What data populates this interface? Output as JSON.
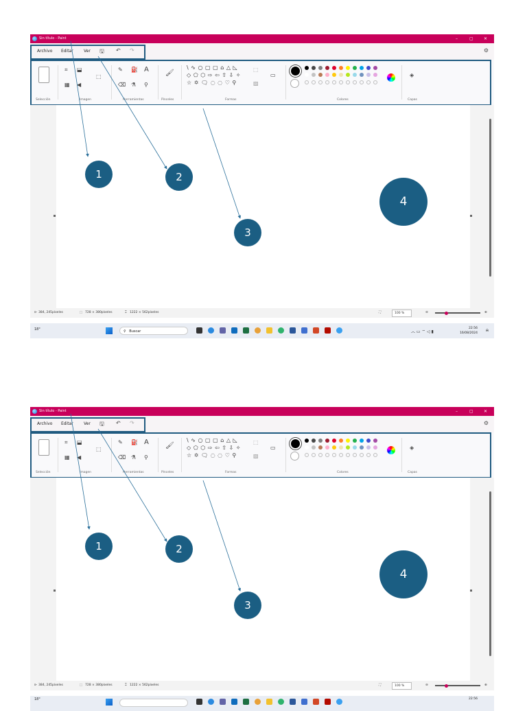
{
  "window": {
    "title": "Sin título - Paint",
    "controls": [
      "–",
      "▢",
      "✕"
    ]
  },
  "menu": {
    "items": [
      "Archivo",
      "Editar",
      "Ver"
    ],
    "icons": [
      "save-icon",
      "undo-icon",
      "redo-icon",
      "settings-icon"
    ]
  },
  "ribbon": {
    "groups": [
      "Selección",
      "Imagen",
      "Herramientas",
      "Pinceles",
      "Formas",
      "Colores",
      "Capas"
    ],
    "shapes_row1": "\\ ∿ ○ ▢ ▢ ⌂ △ ◺",
    "shapes_row2": "◇ ⬠ ⬡ ⇨ ⇦ ⇧ ⇩ ✧",
    "shapes_row3": "☆ ✡ 🗨 ◌ ◌ ♡ ⚲",
    "palette_row1": [
      "#000000",
      "#464646",
      "#7f7f7f",
      "#9c1a2e",
      "#e0002a",
      "#ff7f27",
      "#fff200",
      "#22b14c",
      "#00a2e8",
      "#3f48cc",
      "#a349a4"
    ],
    "palette_row2": [
      "#ffffff",
      "#c3c3c3",
      "#b97a57",
      "#ffaec9",
      "#ffc90e",
      "#efe4b0",
      "#b5e61d",
      "#99d9ea",
      "#7092be",
      "#c8bfe7",
      "#e5a5e0"
    ]
  },
  "status": {
    "cursor": "384, 245píxeles",
    "selection": "728 × 380píxeles",
    "canvas_size": "1222 × 562píxeles",
    "zoom": "100 %"
  },
  "taskbar": {
    "search_placeholder": "Buscar",
    "weather": "18°",
    "time": "22:56",
    "date": "16/08/2024"
  },
  "annotations": {
    "labels": [
      "1",
      "2",
      "3",
      "4"
    ],
    "highlight_color": "#1f5a80",
    "badge_color": "#1b5e83"
  }
}
